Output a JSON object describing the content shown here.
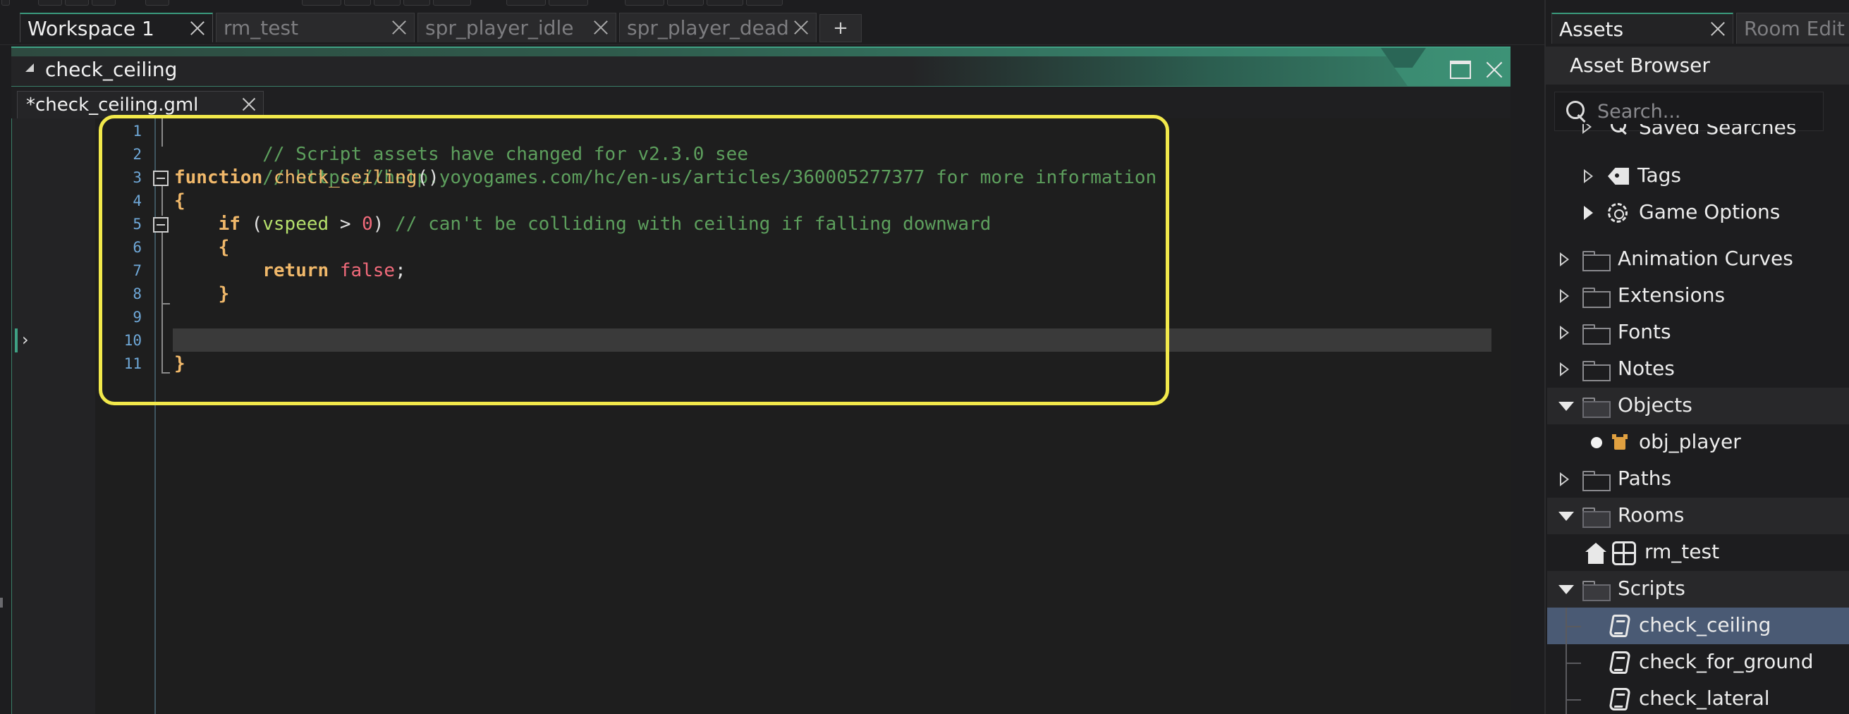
{
  "workspace_tabs": [
    {
      "label": "Workspace 1",
      "active": true
    },
    {
      "label": "rm_test",
      "active": false
    },
    {
      "label": "spr_player_idle",
      "active": false
    },
    {
      "label": "spr_player_dead",
      "active": false
    }
  ],
  "add_tab_label": "+",
  "editor": {
    "window_title": "check_ceiling",
    "file_tab": "*check_ceiling.gml",
    "line_numbers": [
      "1",
      "2",
      "3",
      "4",
      "5",
      "6",
      "7",
      "8",
      "9",
      "10",
      "11"
    ],
    "code": {
      "l1": "// Script assets have changed for v2.3.0 see",
      "l2": "// https://help.yoyogames.com/hc/en-us/articles/360005277377 for more information",
      "l3_kw": "function",
      "l3_name": " check_ceiling",
      "l3_paren": "()",
      "l4": "{",
      "l5_indent": "    ",
      "l5_kw": "if",
      "l5_open": " (",
      "l5_var": "vspeed",
      "l5_op": " > ",
      "l5_num": "0",
      "l5_close": ") ",
      "l5_comment": "// can't be colliding with ceiling if falling downward",
      "l6": "    {",
      "l7_indent": "        ",
      "l7_kw": "return",
      "l7_space": " ",
      "l7_val": "false",
      "l7_semi": ";",
      "l8": "    }",
      "l11": "}"
    },
    "caret_glyph": "›"
  },
  "assets_panel": {
    "tab_active": "Assets",
    "tab_inactive": "Room Edit",
    "header": "Asset Browser",
    "search_placeholder": "Search...",
    "items": {
      "saved_searches": "Saved Searches",
      "tags": "Tags",
      "game_options": "Game Options",
      "animation_curves": "Animation Curves",
      "extensions": "Extensions",
      "fonts": "Fonts",
      "notes": "Notes",
      "objects": "Objects",
      "obj_player": "obj_player",
      "paths": "Paths",
      "rooms": "Rooms",
      "rm_test": "rm_test",
      "scripts": "Scripts",
      "check_ceiling": "check_ceiling",
      "check_for_ground": "check_for_ground",
      "check_lateral": "check_lateral"
    }
  },
  "colors": {
    "accent": "#3fa184",
    "highlight_box": "#f2e94b",
    "selected_row": "#4a5a74",
    "comment": "#5d9f5d",
    "keyword": "#f0b86a",
    "number": "#f06a7a",
    "variable": "#b5e06c"
  }
}
